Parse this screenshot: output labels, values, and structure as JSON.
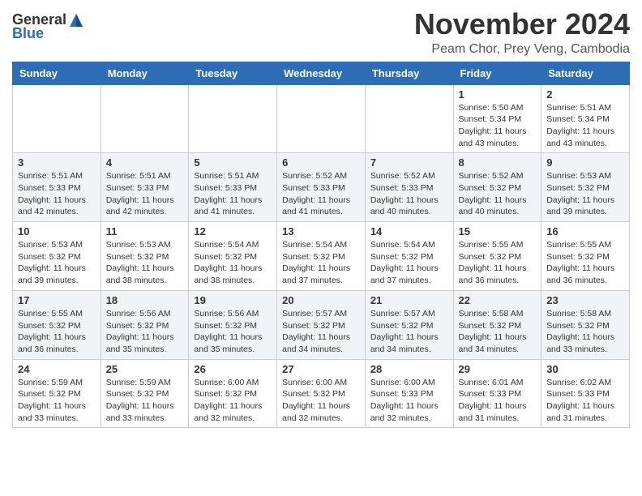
{
  "logo": {
    "general": "General",
    "blue": "Blue"
  },
  "header": {
    "month_title": "November 2024",
    "location": "Peam Chor, Prey Veng, Cambodia"
  },
  "days_of_week": [
    "Sunday",
    "Monday",
    "Tuesday",
    "Wednesday",
    "Thursday",
    "Friday",
    "Saturday"
  ],
  "weeks": [
    [
      {
        "day": "",
        "info": ""
      },
      {
        "day": "",
        "info": ""
      },
      {
        "day": "",
        "info": ""
      },
      {
        "day": "",
        "info": ""
      },
      {
        "day": "",
        "info": ""
      },
      {
        "day": "1",
        "info": "Sunrise: 5:50 AM\nSunset: 5:34 PM\nDaylight: 11 hours\nand 43 minutes."
      },
      {
        "day": "2",
        "info": "Sunrise: 5:51 AM\nSunset: 5:34 PM\nDaylight: 11 hours\nand 43 minutes."
      }
    ],
    [
      {
        "day": "3",
        "info": "Sunrise: 5:51 AM\nSunset: 5:33 PM\nDaylight: 11 hours\nand 42 minutes."
      },
      {
        "day": "4",
        "info": "Sunrise: 5:51 AM\nSunset: 5:33 PM\nDaylight: 11 hours\nand 42 minutes."
      },
      {
        "day": "5",
        "info": "Sunrise: 5:51 AM\nSunset: 5:33 PM\nDaylight: 11 hours\nand 41 minutes."
      },
      {
        "day": "6",
        "info": "Sunrise: 5:52 AM\nSunset: 5:33 PM\nDaylight: 11 hours\nand 41 minutes."
      },
      {
        "day": "7",
        "info": "Sunrise: 5:52 AM\nSunset: 5:33 PM\nDaylight: 11 hours\nand 40 minutes."
      },
      {
        "day": "8",
        "info": "Sunrise: 5:52 AM\nSunset: 5:32 PM\nDaylight: 11 hours\nand 40 minutes."
      },
      {
        "day": "9",
        "info": "Sunrise: 5:53 AM\nSunset: 5:32 PM\nDaylight: 11 hours\nand 39 minutes."
      }
    ],
    [
      {
        "day": "10",
        "info": "Sunrise: 5:53 AM\nSunset: 5:32 PM\nDaylight: 11 hours\nand 39 minutes."
      },
      {
        "day": "11",
        "info": "Sunrise: 5:53 AM\nSunset: 5:32 PM\nDaylight: 11 hours\nand 38 minutes."
      },
      {
        "day": "12",
        "info": "Sunrise: 5:54 AM\nSunset: 5:32 PM\nDaylight: 11 hours\nand 38 minutes."
      },
      {
        "day": "13",
        "info": "Sunrise: 5:54 AM\nSunset: 5:32 PM\nDaylight: 11 hours\nand 37 minutes."
      },
      {
        "day": "14",
        "info": "Sunrise: 5:54 AM\nSunset: 5:32 PM\nDaylight: 11 hours\nand 37 minutes."
      },
      {
        "day": "15",
        "info": "Sunrise: 5:55 AM\nSunset: 5:32 PM\nDaylight: 11 hours\nand 36 minutes."
      },
      {
        "day": "16",
        "info": "Sunrise: 5:55 AM\nSunset: 5:32 PM\nDaylight: 11 hours\nand 36 minutes."
      }
    ],
    [
      {
        "day": "17",
        "info": "Sunrise: 5:55 AM\nSunset: 5:32 PM\nDaylight: 11 hours\nand 36 minutes."
      },
      {
        "day": "18",
        "info": "Sunrise: 5:56 AM\nSunset: 5:32 PM\nDaylight: 11 hours\nand 35 minutes."
      },
      {
        "day": "19",
        "info": "Sunrise: 5:56 AM\nSunset: 5:32 PM\nDaylight: 11 hours\nand 35 minutes."
      },
      {
        "day": "20",
        "info": "Sunrise: 5:57 AM\nSunset: 5:32 PM\nDaylight: 11 hours\nand 34 minutes."
      },
      {
        "day": "21",
        "info": "Sunrise: 5:57 AM\nSunset: 5:32 PM\nDaylight: 11 hours\nand 34 minutes."
      },
      {
        "day": "22",
        "info": "Sunrise: 5:58 AM\nSunset: 5:32 PM\nDaylight: 11 hours\nand 34 minutes."
      },
      {
        "day": "23",
        "info": "Sunrise: 5:58 AM\nSunset: 5:32 PM\nDaylight: 11 hours\nand 33 minutes."
      }
    ],
    [
      {
        "day": "24",
        "info": "Sunrise: 5:59 AM\nSunset: 5:32 PM\nDaylight: 11 hours\nand 33 minutes."
      },
      {
        "day": "25",
        "info": "Sunrise: 5:59 AM\nSunset: 5:32 PM\nDaylight: 11 hours\nand 33 minutes."
      },
      {
        "day": "26",
        "info": "Sunrise: 6:00 AM\nSunset: 5:32 PM\nDaylight: 11 hours\nand 32 minutes."
      },
      {
        "day": "27",
        "info": "Sunrise: 6:00 AM\nSunset: 5:32 PM\nDaylight: 11 hours\nand 32 minutes."
      },
      {
        "day": "28",
        "info": "Sunrise: 6:00 AM\nSunset: 5:33 PM\nDaylight: 11 hours\nand 32 minutes."
      },
      {
        "day": "29",
        "info": "Sunrise: 6:01 AM\nSunset: 5:33 PM\nDaylight: 11 hours\nand 31 minutes."
      },
      {
        "day": "30",
        "info": "Sunrise: 6:02 AM\nSunset: 5:33 PM\nDaylight: 11 hours\nand 31 minutes."
      }
    ]
  ]
}
